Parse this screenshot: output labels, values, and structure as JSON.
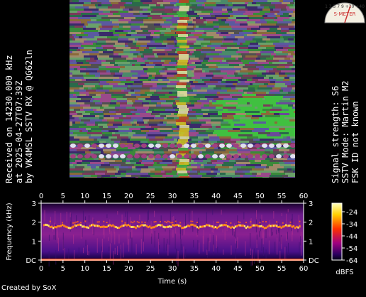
{
  "left_info": {
    "line1": "Received on  14230.000 kHz",
    "line2": "at 2025-04-27T07:39Z",
    "line3": "by VK4MSL SSTV RX @ QG62ln"
  },
  "right_info": {
    "line1": "Signal strength: S6",
    "line2": "SSTV Mode: Martin M2",
    "line3": "FSK ID not known"
  },
  "meter": {
    "scale": "1 3 5 7 9 +20 +40",
    "label": "S-METER",
    "icon": "s-meter-icon"
  },
  "spectrogram": {
    "ylabel": "Frequency (kHz)",
    "xlabel": "Time (s)",
    "x_ticks": [
      "0",
      "5",
      "10",
      "15",
      "20",
      "25",
      "30",
      "35",
      "40",
      "45",
      "50",
      "55",
      "60"
    ],
    "y_ticks": [
      "DC",
      "1",
      "2",
      "3"
    ],
    "colorbar_ticks": [
      "-24",
      "-34",
      "-44",
      "-54",
      "-64"
    ],
    "colorbar_label": "dBFS"
  },
  "credit": "Created by SoX",
  "colors": {
    "background": "#000000",
    "text": "#ffffff",
    "trace": "#ff8a1a"
  }
}
